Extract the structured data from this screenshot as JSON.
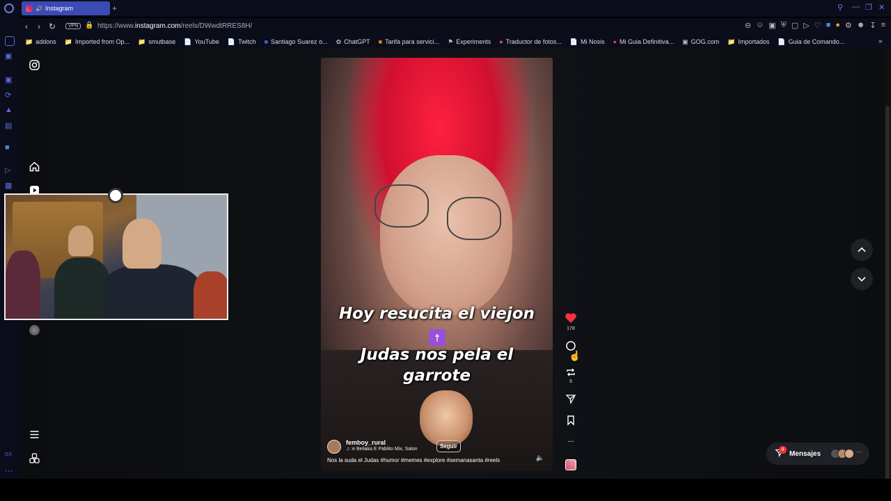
{
  "browser": {
    "tab_title": "Instagram",
    "new_tab": "+",
    "url_prefix": "https://www.",
    "url_domain": "instagram.com",
    "url_path": "/reels/DWwdtRRES8H/",
    "vpn_label": "VPN"
  },
  "bookmarks": [
    {
      "label": "addons",
      "icon": "folder-icon"
    },
    {
      "label": "Imported from Op...",
      "icon": "folder-icon"
    },
    {
      "label": "smutbase",
      "icon": "folder-icon"
    },
    {
      "label": "YouTube",
      "icon": "page-icon"
    },
    {
      "label": "Twitch",
      "icon": "page-icon"
    },
    {
      "label": "Santiago Suarez o...",
      "icon": "behance-icon"
    },
    {
      "label": "ChatGPT",
      "icon": "chatgpt-icon"
    },
    {
      "label": "Tarifa para servici...",
      "icon": "tarifa-icon"
    },
    {
      "label": "Experiments",
      "icon": "flag-icon"
    },
    {
      "label": "Traductor de fotos...",
      "icon": "translate-icon"
    },
    {
      "label": "Mi Nosis",
      "icon": "page-icon"
    },
    {
      "label": "Mi Guia Definitiva...",
      "icon": "guide-icon"
    },
    {
      "label": "GOG.com",
      "icon": "gog-icon"
    },
    {
      "label": "Importados",
      "icon": "folder-icon"
    },
    {
      "label": "Guia de Comando...",
      "icon": "page-icon"
    }
  ],
  "reel": {
    "caption_line1": "Hoy resucita el viejon",
    "caption_emoji": "†",
    "caption_line2": "Judas nos pela el",
    "caption_line3": "garrote",
    "username": "femboy_rural",
    "audio": "♫  :e Beliaka  E  Pablito Mix, Salon",
    "follow_label": "Seguir",
    "description": "Nos la suda el Judas #humor #memes #explore #semanasanta #reels"
  },
  "actions": {
    "likes": "178",
    "shares": "9",
    "more": "..."
  },
  "messages": {
    "label": "Mensajes",
    "badge": "4"
  },
  "colors": {
    "accent": "#3b4bb5",
    "like": "#ff3040",
    "hair": "#e01030"
  }
}
